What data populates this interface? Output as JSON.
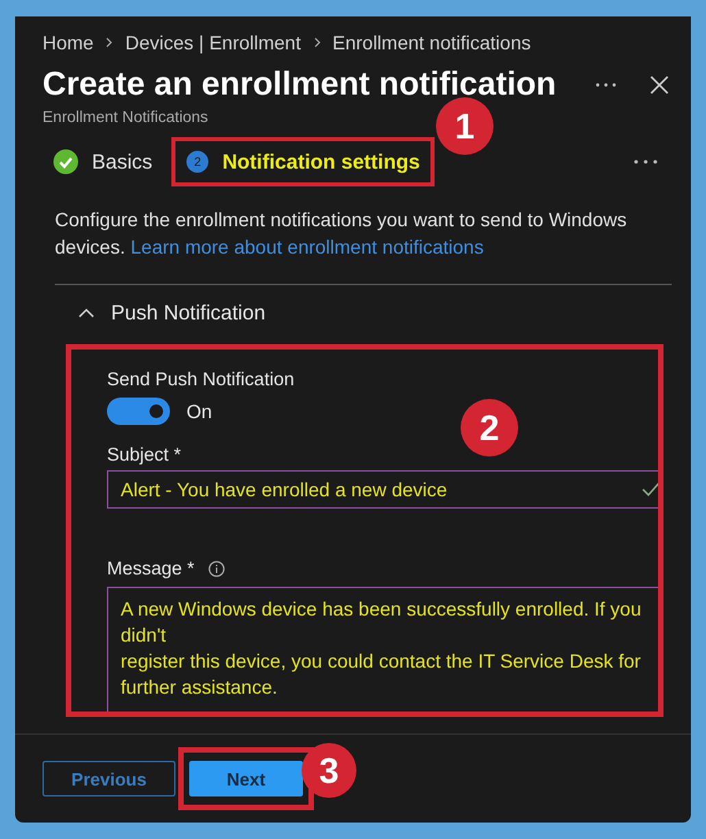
{
  "breadcrumb": [
    "Home",
    "Devices | Enrollment",
    "Enrollment notifications"
  ],
  "title": "Create an enrollment notification",
  "subtitle": "Enrollment Notifications",
  "tabs": [
    {
      "label": "Basics",
      "kind": "done",
      "selected": false,
      "highlighted": false
    },
    {
      "label": "Notification settings",
      "kind": "current",
      "number": "2",
      "selected": true,
      "highlighted": true,
      "callout": "1"
    }
  ],
  "description": {
    "text": "Configure the enrollment notifications you want to send to Windows devices.",
    "link": "Learn more about enrollment notifications"
  },
  "section": {
    "title": "Push Notification",
    "expanded": true,
    "highlighted": true,
    "callout": "2",
    "toggle": {
      "label": "Send Push Notification",
      "on": true,
      "state_text": "On"
    },
    "subject": {
      "label": "Subject *",
      "value": "Alert - You have enrolled a new device",
      "valid": true,
      "highlighted": true
    },
    "message": {
      "label": "Message *",
      "value": "A new Windows device has been successfully enrolled. If you didn't\nregister this device, you could contact the IT Service Desk for further assistance.",
      "highlighted": true
    }
  },
  "buttons": [
    {
      "label": "Previous",
      "kind": "secondary",
      "highlighted": false
    },
    {
      "label": "Next",
      "kind": "primary",
      "highlighted": true,
      "callout": "3"
    }
  ]
}
